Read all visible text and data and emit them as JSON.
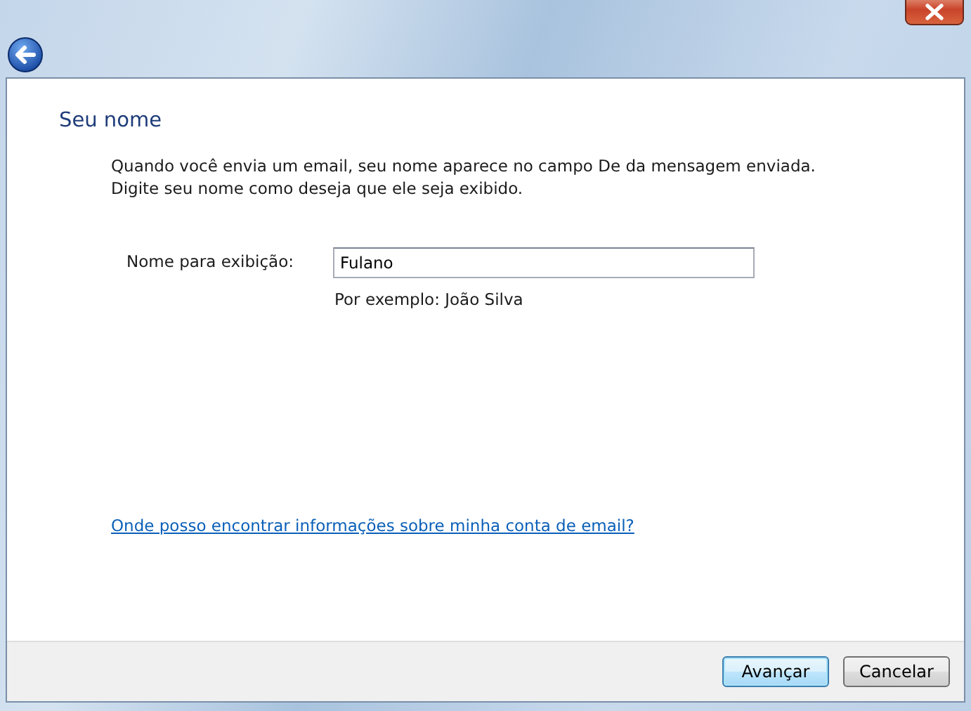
{
  "heading": "Seu nome",
  "description": [
    "Quando você envia um email, seu nome aparece no campo De da mensagem enviada.",
    "Digite seu nome como deseja que ele seja exibido."
  ],
  "field": {
    "label": "Nome para exibição:",
    "value": "Fulano",
    "hint": "Por exemplo: João Silva"
  },
  "help_link": "Onde posso encontrar informações sobre minha conta de email?",
  "buttons": [
    {
      "label": "Avançar",
      "kind": "default"
    },
    {
      "label": "Cancelar",
      "kind": "normal"
    }
  ]
}
